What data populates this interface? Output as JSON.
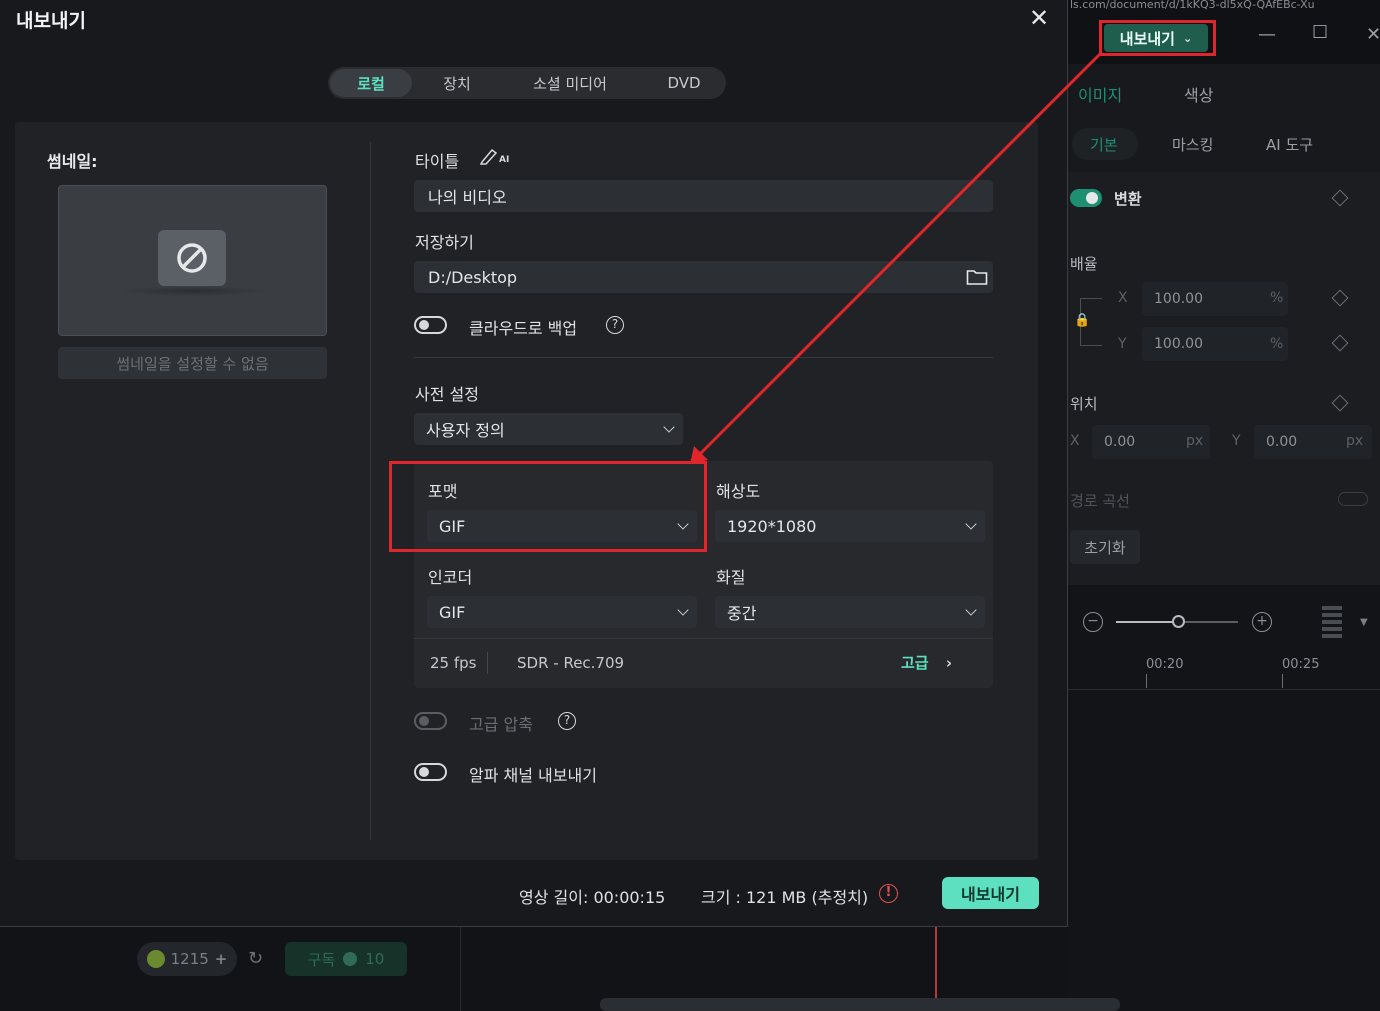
{
  "background": {
    "url_fragment": "ls.com/document/d/1kKQ3-dl5xQ-QAfEBc-Xu",
    "export_button_label": "내보내기",
    "tabs": [
      "이미지",
      "색상"
    ],
    "subtabs": [
      "기본",
      "마스킹",
      "AI 도구"
    ],
    "transform_label": "변환",
    "scale_label": "배율",
    "scale_x_label": "X",
    "scale_y_label": "Y",
    "scale_x_value": "100.00",
    "scale_y_value": "100.00",
    "percent_unit": "%",
    "position_label": "위치",
    "pos_x_label": "X",
    "pos_y_label": "Y",
    "pos_x_value": "0.00",
    "pos_y_value": "0.00",
    "px_unit": "px",
    "path_curve_label": "경로 곡선",
    "reset_label": "초기화",
    "ruler_ticks": [
      "00:20",
      "00:25"
    ],
    "credits": "1215",
    "subscribe_label": "구독",
    "subscribe_count": "10"
  },
  "dialog": {
    "title": "내보내기",
    "tabs": [
      {
        "label": "로컬",
        "active": true
      },
      {
        "label": "장치",
        "active": false
      },
      {
        "label": "소셜 미디어",
        "active": false
      },
      {
        "label": "DVD",
        "active": false
      }
    ],
    "thumbnail_label": "썸네일:",
    "thumbnail_button": "썸네일을 설정할 수 없음",
    "title_label": "타이틀",
    "ai_badge": "AI",
    "title_value": "나의 비디오",
    "save_label": "저장하기",
    "save_path": "D:/Desktop",
    "cloud_backup_label": "클라우드로 백업",
    "preset_label": "사전 설정",
    "preset_value": "사용자 정의",
    "format_label": "포맷",
    "format_value": "GIF",
    "resolution_label": "해상도",
    "resolution_value": "1920*1080",
    "encoder_label": "인코더",
    "encoder_value": "GIF",
    "quality_label": "화질",
    "quality_value": "중간",
    "fps": "25 fps",
    "color_space": "SDR - Rec.709",
    "advanced_label": "고급",
    "advanced_compress_label": "고급 압축",
    "alpha_channel_label": "알파 채널 내보내기",
    "duration_text": "영상 길이: 00:00:15",
    "size_text": "크기 :  121 MB (추정치)",
    "export_button": "내보내기"
  },
  "colors": {
    "accent": "#5ce0c0",
    "highlight": "#e0262b"
  }
}
